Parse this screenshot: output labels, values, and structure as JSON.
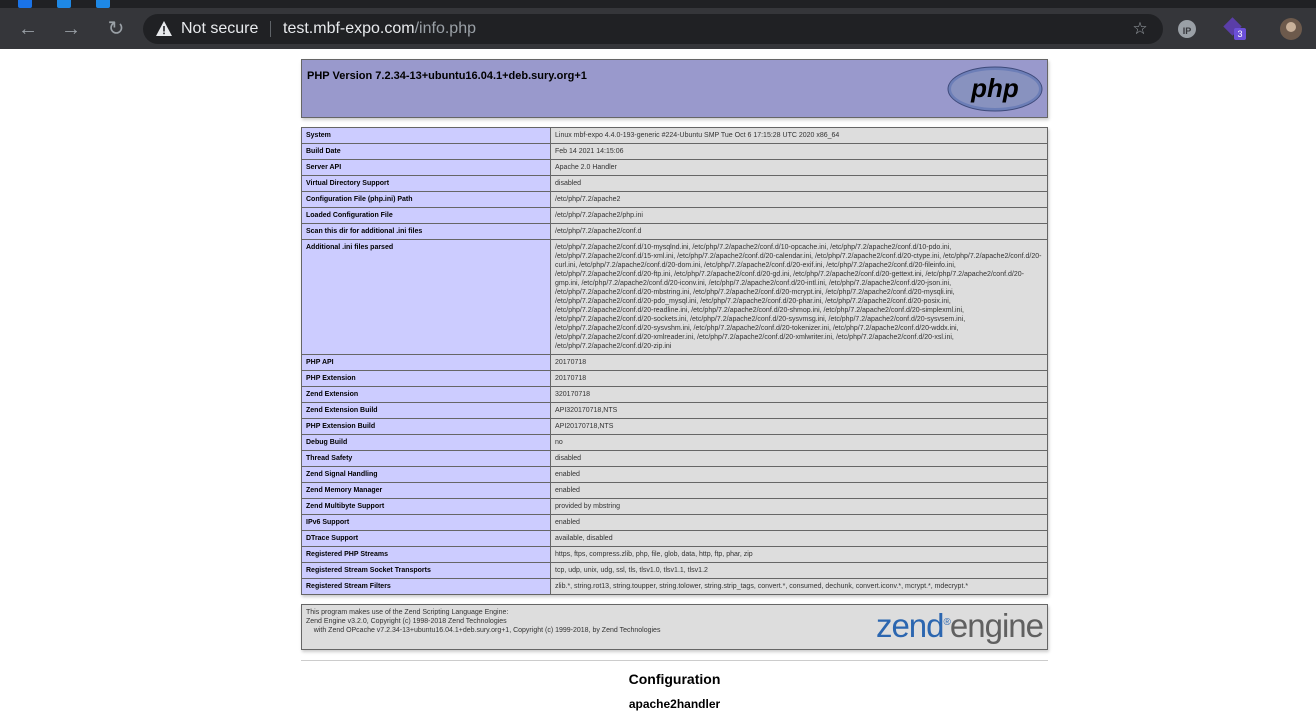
{
  "browser": {
    "security_label": "Not secure",
    "url_host": "test.mbf-expo.com",
    "url_path": "/info.php",
    "extension_badge": "3",
    "extension_ip_label": "IP"
  },
  "php": {
    "version_title": "PHP Version 7.2.34-13+ubuntu16.04.1+deb.sury.org+1",
    "logo_text": "php",
    "rows": [
      {
        "k": "System",
        "v": "Linux mbf-expo 4.4.0-193-generic #224-Ubuntu SMP Tue Oct 6 17:15:28 UTC 2020 x86_64"
      },
      {
        "k": "Build Date",
        "v": "Feb 14 2021 14:15:06"
      },
      {
        "k": "Server API",
        "v": "Apache 2.0 Handler"
      },
      {
        "k": "Virtual Directory Support",
        "v": "disabled"
      },
      {
        "k": "Configuration File (php.ini) Path",
        "v": "/etc/php/7.2/apache2"
      },
      {
        "k": "Loaded Configuration File",
        "v": "/etc/php/7.2/apache2/php.ini"
      },
      {
        "k": "Scan this dir for additional .ini files",
        "v": "/etc/php/7.2/apache2/conf.d"
      },
      {
        "k": "Additional .ini files parsed",
        "v": "/etc/php/7.2/apache2/conf.d/10-mysqlnd.ini, /etc/php/7.2/apache2/conf.d/10-opcache.ini, /etc/php/7.2/apache2/conf.d/10-pdo.ini, /etc/php/7.2/apache2/conf.d/15-xml.ini, /etc/php/7.2/apache2/conf.d/20-calendar.ini, /etc/php/7.2/apache2/conf.d/20-ctype.ini, /etc/php/7.2/apache2/conf.d/20-curl.ini, /etc/php/7.2/apache2/conf.d/20-dom.ini, /etc/php/7.2/apache2/conf.d/20-exif.ini, /etc/php/7.2/apache2/conf.d/20-fileinfo.ini, /etc/php/7.2/apache2/conf.d/20-ftp.ini, /etc/php/7.2/apache2/conf.d/20-gd.ini, /etc/php/7.2/apache2/conf.d/20-gettext.ini, /etc/php/7.2/apache2/conf.d/20-gmp.ini, /etc/php/7.2/apache2/conf.d/20-iconv.ini, /etc/php/7.2/apache2/conf.d/20-intl.ini, /etc/php/7.2/apache2/conf.d/20-json.ini, /etc/php/7.2/apache2/conf.d/20-mbstring.ini, /etc/php/7.2/apache2/conf.d/20-mcrypt.ini, /etc/php/7.2/apache2/conf.d/20-mysqli.ini, /etc/php/7.2/apache2/conf.d/20-pdo_mysql.ini, /etc/php/7.2/apache2/conf.d/20-phar.ini, /etc/php/7.2/apache2/conf.d/20-posix.ini, /etc/php/7.2/apache2/conf.d/20-readline.ini, /etc/php/7.2/apache2/conf.d/20-shmop.ini, /etc/php/7.2/apache2/conf.d/20-simplexml.ini, /etc/php/7.2/apache2/conf.d/20-sockets.ini, /etc/php/7.2/apache2/conf.d/20-sysvmsg.ini, /etc/php/7.2/apache2/conf.d/20-sysvsem.ini, /etc/php/7.2/apache2/conf.d/20-sysvshm.ini, /etc/php/7.2/apache2/conf.d/20-tokenizer.ini, /etc/php/7.2/apache2/conf.d/20-wddx.ini, /etc/php/7.2/apache2/conf.d/20-xmlreader.ini, /etc/php/7.2/apache2/conf.d/20-xmlwriter.ini, /etc/php/7.2/apache2/conf.d/20-xsl.ini, /etc/php/7.2/apache2/conf.d/20-zip.ini"
      },
      {
        "k": "PHP API",
        "v": "20170718"
      },
      {
        "k": "PHP Extension",
        "v": "20170718"
      },
      {
        "k": "Zend Extension",
        "v": "320170718"
      },
      {
        "k": "Zend Extension Build",
        "v": "API320170718,NTS"
      },
      {
        "k": "PHP Extension Build",
        "v": "API20170718,NTS"
      },
      {
        "k": "Debug Build",
        "v": "no"
      },
      {
        "k": "Thread Safety",
        "v": "disabled"
      },
      {
        "k": "Zend Signal Handling",
        "v": "enabled"
      },
      {
        "k": "Zend Memory Manager",
        "v": "enabled"
      },
      {
        "k": "Zend Multibyte Support",
        "v": "provided by mbstring"
      },
      {
        "k": "IPv6 Support",
        "v": "enabled"
      },
      {
        "k": "DTrace Support",
        "v": "available, disabled"
      },
      {
        "k": "Registered PHP Streams",
        "v": "https, ftps, compress.zlib, php, file, glob, data, http, ftp, phar, zip"
      },
      {
        "k": "Registered Stream Socket Transports",
        "v": "tcp, udp, unix, udg, ssl, tls, tlsv1.0, tlsv1.1, tlsv1.2"
      },
      {
        "k": "Registered Stream Filters",
        "v": "zlib.*, string.rot13, string.toupper, string.tolower, string.strip_tags, convert.*, consumed, dechunk, convert.iconv.*, mcrypt.*, mdecrypt.*"
      }
    ],
    "zend_text": "This program makes use of the Zend Scripting Language Engine:\nZend Engine v3.2.0, Copyright (c) 1998-2018 Zend Technologies\n    with Zend OPcache v7.2.34-13+ubuntu16.04.1+deb.sury.org+1, Copyright (c) 1999-2018, by Zend Technologies",
    "zend_logo_a": "zend",
    "zend_logo_b": "engine",
    "zend_logo_reg": "®",
    "config_heading": "Configuration",
    "module_heading": "apache2handler"
  }
}
